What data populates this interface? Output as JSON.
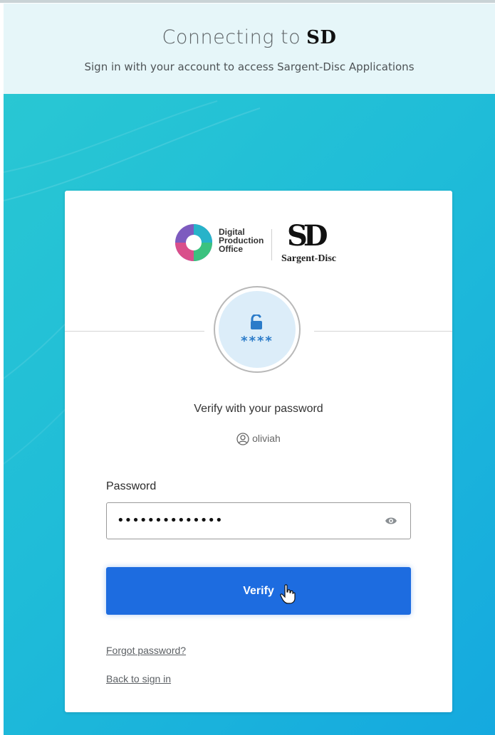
{
  "header": {
    "title": "Connecting to",
    "brand_mark": "SD",
    "subtitle": "Sign in with your account to access Sargent-Disc Applications"
  },
  "logos": {
    "dpo_lines": [
      "Digital",
      "Production",
      "Office"
    ],
    "sd_mark": "SD",
    "sd_name": "Sargent-Disc"
  },
  "badge": {
    "stars": "****",
    "icon": "unlock-icon"
  },
  "verify": {
    "title": "Verify with your password",
    "username": "oliviah"
  },
  "password": {
    "label": "Password",
    "value": "••••••••••••••"
  },
  "button": {
    "label": "Verify"
  },
  "links": {
    "forgot": "Forgot password?",
    "back": "Back to sign in"
  },
  "colors": {
    "accent": "#1d6ce0",
    "background_start": "#29c7d3",
    "background_end": "#15a9df",
    "header_bg": "#e6f6f9"
  }
}
